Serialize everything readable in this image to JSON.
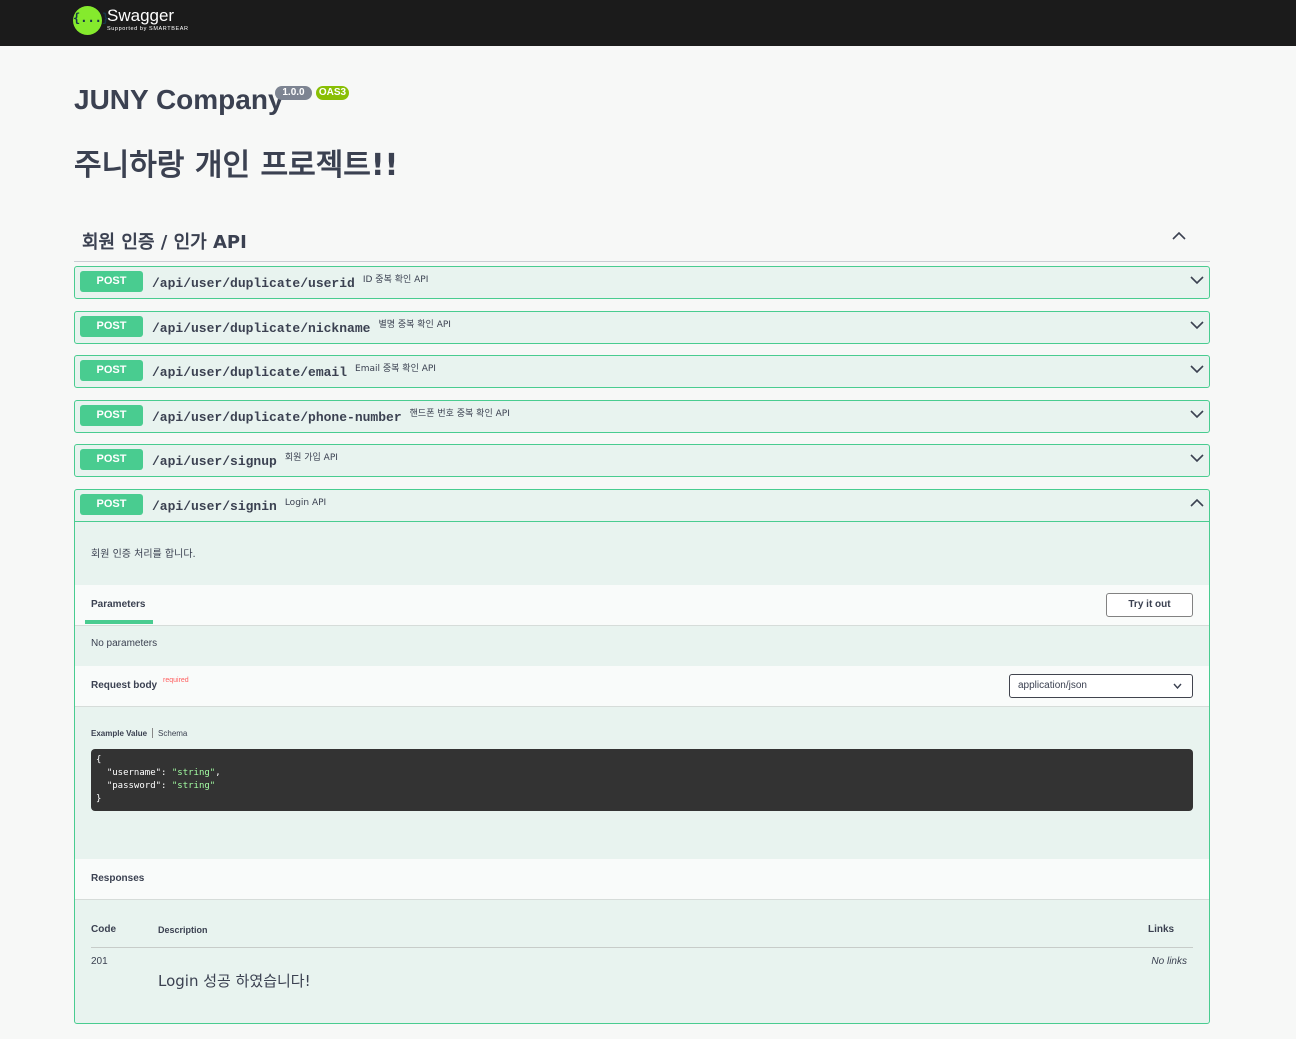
{
  "topbar": {
    "logo_glyph": "{...}",
    "logo_name": "Swagger",
    "logo_sub": "Supported by SMARTBEAR",
    "bg_color": "#1b1b1b",
    "logo_color": "#85ea2d"
  },
  "info": {
    "title": "JUNY Company",
    "version": "1.0.0",
    "oas": "OAS3",
    "description": "주니하랑 개인 프로젝트!!"
  },
  "tag": {
    "name": "회원 인증 / 인가 API",
    "expanded": true
  },
  "colors": {
    "post": "#49cc90",
    "post_bg": "#e8f3ef",
    "required": "#ff6060"
  },
  "operations": [
    {
      "method": "POST",
      "path": "/api/user/duplicate/userid",
      "summary": "ID 중복 확인 API"
    },
    {
      "method": "POST",
      "path": "/api/user/duplicate/nickname",
      "summary": "별명 중복 확인 API"
    },
    {
      "method": "POST",
      "path": "/api/user/duplicate/email",
      "summary": "Email 중복 확인 API"
    },
    {
      "method": "POST",
      "path": "/api/user/duplicate/phone-number",
      "summary": "핸드폰 번호 중복 확인 API"
    },
    {
      "method": "POST",
      "path": "/api/user/signup",
      "summary": "회원 가입 API"
    }
  ],
  "opened": {
    "method": "POST",
    "path": "/api/user/signin",
    "summary": "Login API",
    "description": "회원 인증 처리를 합니다.",
    "parameters_tab": "Parameters",
    "try_it_out": "Try it out",
    "no_parameters": "No parameters",
    "request_body_label": "Request body",
    "required_label": "required",
    "content_type": "application/json",
    "example_value_tab": "Example Value",
    "schema_tab": "Schema",
    "example": {
      "open": "{",
      "k1": "\"username\"",
      "v1": "\"string\"",
      "k2": "\"password\"",
      "v2": "\"string\"",
      "close": "}"
    },
    "responses_label": "Responses",
    "table_headers": {
      "code": "Code",
      "description": "Description",
      "links": "Links"
    },
    "responses": [
      {
        "code": "201",
        "description": "Login 성공 하였습니다!",
        "links": "No links"
      }
    ]
  }
}
